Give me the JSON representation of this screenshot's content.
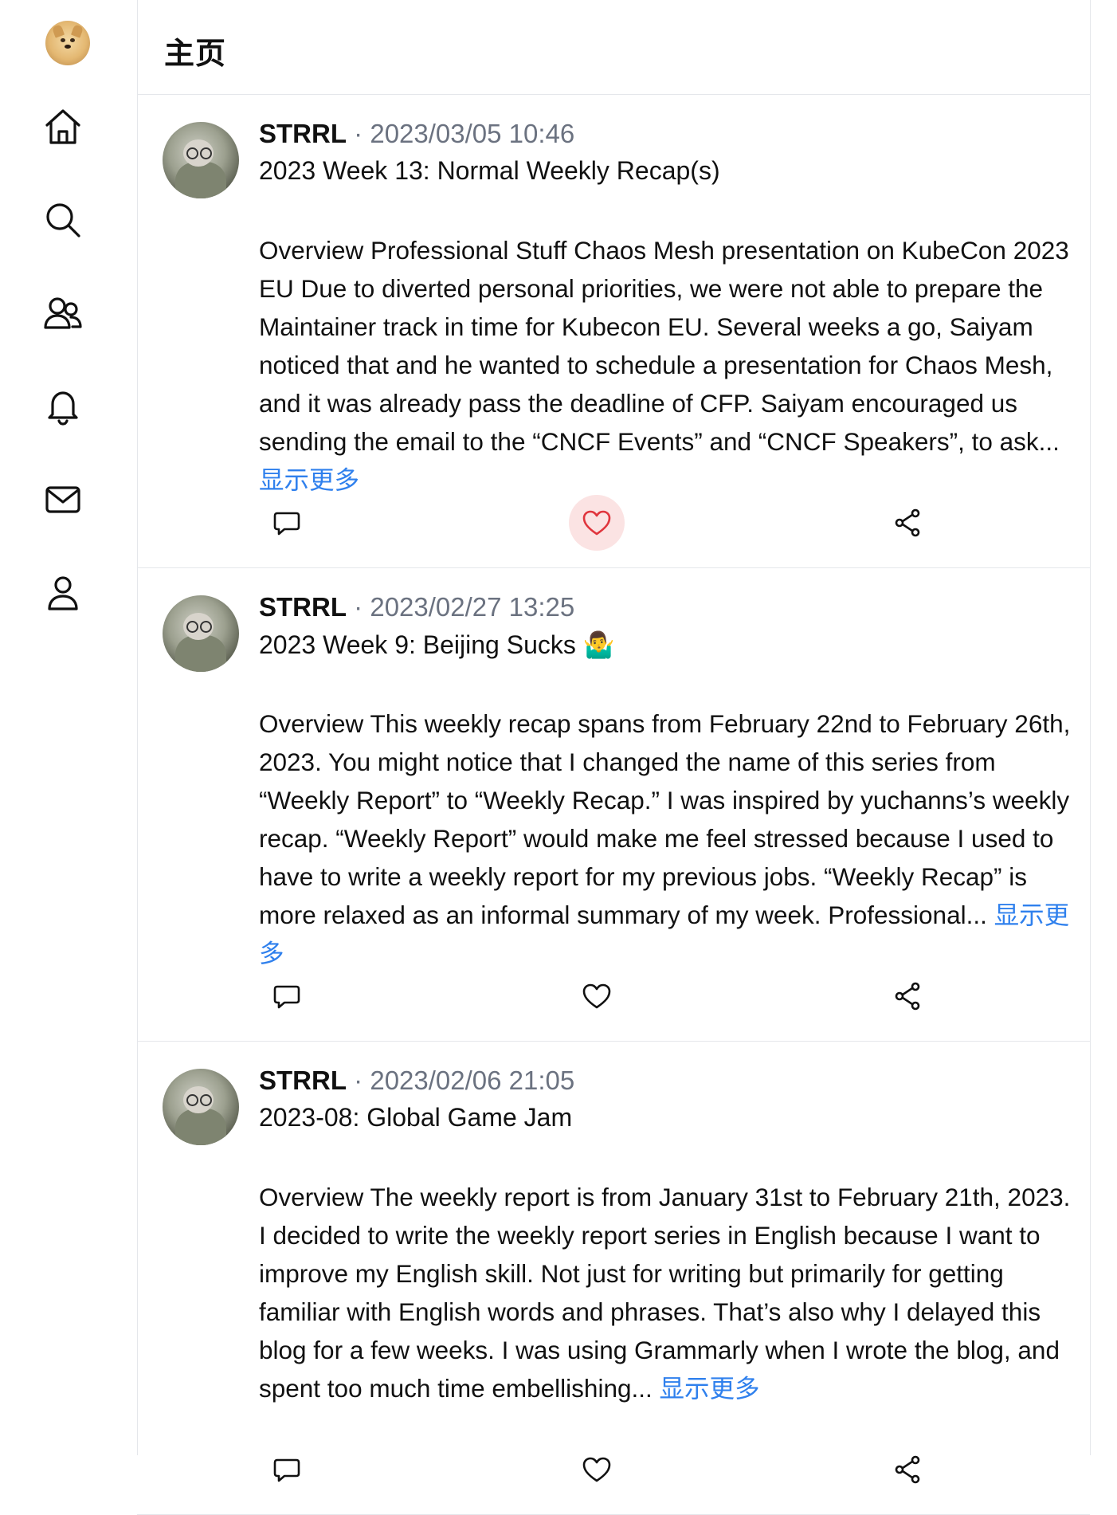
{
  "sidebar": {
    "logo": "doge-logo",
    "items": [
      {
        "icon": "home-icon"
      },
      {
        "icon": "search-icon"
      },
      {
        "icon": "users-icon"
      },
      {
        "icon": "bell-icon"
      },
      {
        "icon": "mail-icon"
      },
      {
        "icon": "user-icon"
      }
    ]
  },
  "header": {
    "title": "主页"
  },
  "posts": [
    {
      "author": "STRRL",
      "separator": "·",
      "date": "2023/03/05 10:46",
      "title": "2023 Week 13: Normal Weekly Recap(s)",
      "excerpt": "Overview Professional Stuff Chaos Mesh presentation on KubeCon 2023 EU Due to diverted personal priorities, we were not able to prepare the Maintainer track in time for Kubecon EU. Several weeks a go, Saiyam noticed that and he wanted to schedule a presentation for Chaos Mesh, and it was already pass the deadline of CFP. Saiyam encouraged us sending the email to the “CNCF Events” and “CNCF Speakers”, to ask...",
      "more": "显示更多",
      "liked": true
    },
    {
      "author": "STRRL",
      "separator": "·",
      "date": "2023/02/27 13:25",
      "title": "2023 Week 9: Beijing Sucks 🤷‍♂️",
      "excerpt": "Overview This weekly recap spans from February 22nd to February 26th, 2023. You might notice that I changed the name of this series from “Weekly Report” to “Weekly Recap.” I was inspired by yuchanns’s weekly recap. “Weekly Report” would make me feel stressed because I used to have to write a weekly report for my previous jobs. “Weekly Recap” is more relaxed as an informal summary of my week. Professional...",
      "more": "显示更多",
      "liked": false
    },
    {
      "author": "STRRL",
      "separator": "·",
      "date": "2023/02/06 21:05",
      "title": "2023-08: Global Game Jam",
      "excerpt": "Overview The weekly report is from January 31st to February 21th, 2023. I decided to write the weekly report series in English because I want to improve my English skill. Not just for writing but primarily for getting familiar with English words and phrases. That’s also why I delayed this blog for a few weeks. I was using Grammarly when I wrote the blog, and spent too much time embellishing...",
      "more": "显示更多",
      "liked": false
    }
  ],
  "colors": {
    "link": "#2f80ed",
    "like_active": "#e0353d",
    "like_bg": "#fbe3e3",
    "meta": "#6b7280"
  }
}
